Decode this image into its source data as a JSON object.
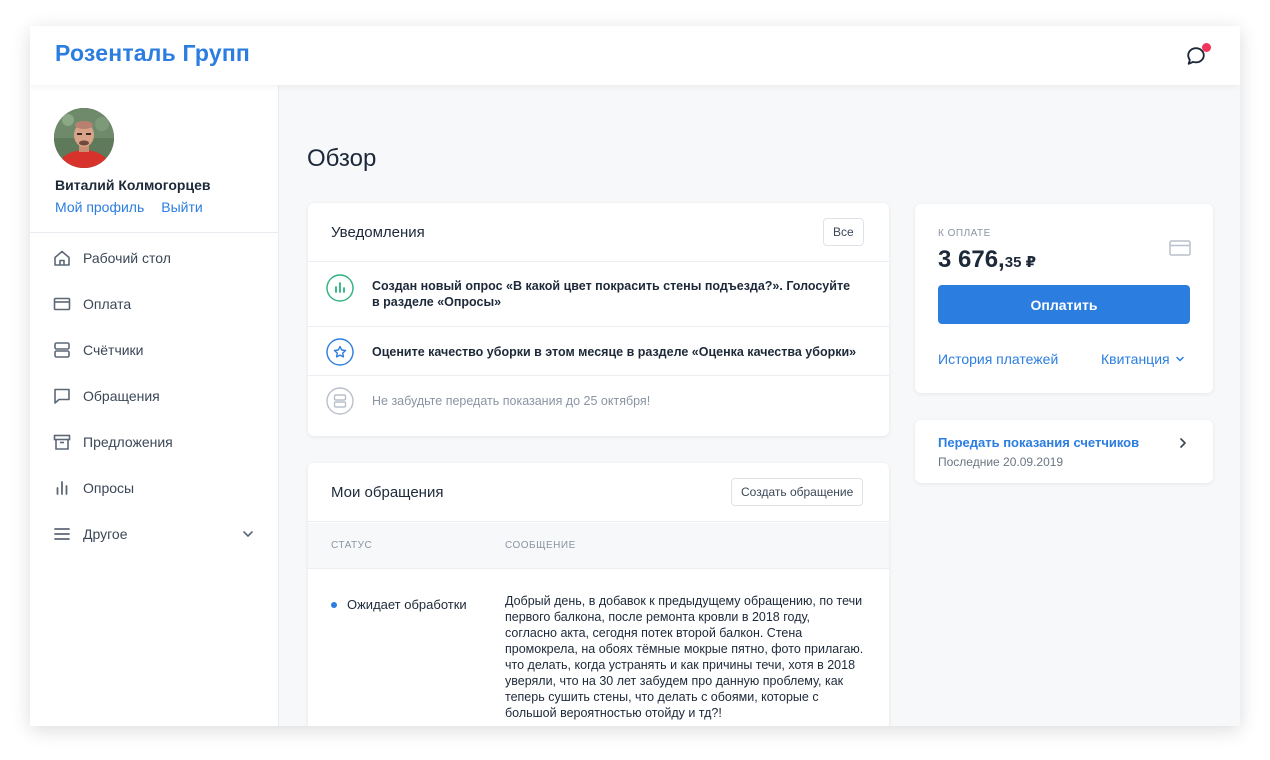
{
  "header": {
    "brand": "Розенталь Групп",
    "chat_icon": "chat-bubble-icon",
    "notification_color": "#f2345a"
  },
  "user": {
    "name": "Виталий Колмогорцев",
    "profile_link": "Мой профиль",
    "logout_link": "Выйти"
  },
  "sidebar": {
    "items": [
      {
        "label": "Рабочий стол",
        "icon": "home-icon"
      },
      {
        "label": "Оплата",
        "icon": "credit-card-icon"
      },
      {
        "label": "Счётчики",
        "icon": "meter-icon"
      },
      {
        "label": "Обращения",
        "icon": "message-icon"
      },
      {
        "label": "Предложения",
        "icon": "archive-icon"
      },
      {
        "label": "Опросы",
        "icon": "bar-chart-icon"
      },
      {
        "label": "Другое",
        "icon": "menu-icon"
      }
    ]
  },
  "page": {
    "title": "Обзор"
  },
  "notifications": {
    "title": "Уведомления",
    "all_button": "Все",
    "items": [
      {
        "text": "Создан новый опрос «В какой цвет покрасить стены подъезда?». Голосуйте в разделе «Опросы»",
        "icon": "poll-icon",
        "color": "#2ab27b"
      },
      {
        "text": "Оцените качество уборки в этом месяце в разделе «Оценка качества уборки»",
        "icon": "star-icon",
        "color": "#2b7de0"
      },
      {
        "text": "Не забудьте передать показания до 25 октября!",
        "icon": "meter-icon",
        "color": "#b9c0ca"
      }
    ]
  },
  "requests": {
    "title": "Мои обращения",
    "create_button": "Создать обращение",
    "columns": [
      "СТАТУС",
      "СООБЩЕНИЕ"
    ],
    "rows": [
      {
        "status": "Ожидает обработки",
        "message": "Добрый день, в добавок к предыдущему обращению,  по течи первого балкона, после ремонта кровли в 2018 году, согласно акта, сегодня потек второй балкон. Стена промокрела, на обоях тёмные мокрые пятно, фото прилагаю. что делать, когда устранять и как причины течи, хотя в 2018 уверяли, что на 30 лет забудем про данную проблему,  как теперь сушить стены, что делать с обоями, которые с большой вероятностью отойду и тд?!"
      }
    ]
  },
  "payment": {
    "label": "К ОПЛАТЕ",
    "amount_main": "3 676,",
    "amount_cents": "35 ₽",
    "pay_button": "Оплатить",
    "history_link": "История платежей",
    "receipt_link": "Квитанция",
    "accent": "#2b7de0"
  },
  "meters": {
    "title": "Передать показания счетчиков",
    "last": "Последние 20.09.2019"
  }
}
